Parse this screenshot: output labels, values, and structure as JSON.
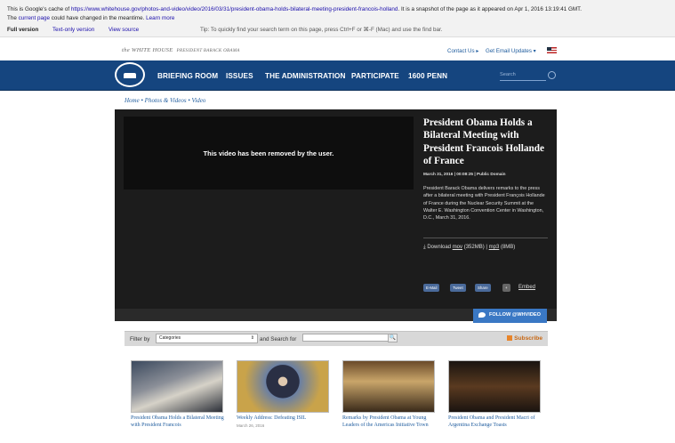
{
  "cache": {
    "line1_a": "This is Google's cache of ",
    "url": "https://www.whitehouse.gov/photos-and-video/video/2016/03/31/president-obama-holds-bilateral-meeting-president-francois-holland",
    "line1_b": ". It is a snapshot of the page as it appeared on Apr 1, 2016 13:19:41 GMT.",
    "line2_a": "The ",
    "current_page": "current page",
    "line2_b": " could have changed in the meantime. ",
    "learn_more": "Learn more",
    "full_version": "Full version",
    "text_only": "Text-only version",
    "view_source": "View source",
    "tip": "Tip: To quickly find your search term on this page, press Ctrl+F or ⌘-F (Mac) and use the find bar."
  },
  "topbar": {
    "brand": "the WHITE HOUSE",
    "brand_sub": "PRESIDENT BARACK OBAMA",
    "contact": "Contact Us ▸",
    "email": "Get Email Updates ▾"
  },
  "nav": {
    "items": [
      "BRIEFING ROOM",
      "ISSUES",
      "THE ADMINISTRATION",
      "PARTICIPATE",
      "1600 PENN"
    ],
    "search_placeholder": "Search"
  },
  "breadcrumb": "Home • Photos & Videos • Video",
  "video": {
    "removed": "This video has been removed by the user.",
    "title": "President Obama Holds a Bilateral Meeting with President Francois Hollande of France",
    "meta": "March 31, 2016 | 00:08:25 | Public Domain",
    "description": "President Barack Obama delivers remarks to the press after a bilateral meeting with President François Hollande of France during the Nuclear Security Summit at the Walter E. Washington Convention Center in Washington, D.C., March 31, 2016.",
    "download_label": "⤓ Download",
    "mov": "mov",
    "mov_size": "(352MB)",
    "sep": "|",
    "mp3": "mp3",
    "mp3_size": "(8MB)",
    "email": "E-Mail",
    "tweet": "Tweet",
    "share": "Share",
    "plus": "+",
    "embed": "Embed"
  },
  "follow": "FOLLOW @WHVIDEO",
  "filter": {
    "filter_by": "Filter by",
    "category": "Categories",
    "search_for": "and Search for",
    "go": "🔍",
    "subscribe": "Subscribe"
  },
  "thumbs": [
    {
      "title": "President Obama Holds a Bilateral Meeting with President Francois",
      "date": ""
    },
    {
      "title": "Weekly Address: Defeating ISIL",
      "date": "March 26, 2016"
    },
    {
      "title": "Remarks by President Obama at Young Leaders of the Americas Initiative Town",
      "date": ""
    },
    {
      "title": "President Obama and President Macri of Argentina Exchange Toasts",
      "date": ""
    }
  ]
}
